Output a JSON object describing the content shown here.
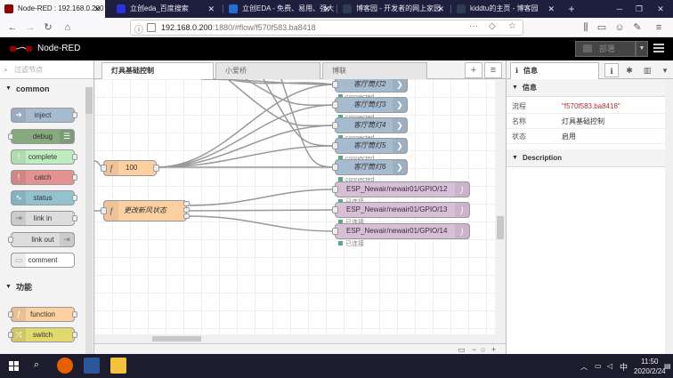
{
  "browser": {
    "tabs": [
      {
        "label": "Node-RED : 192.168.0.200",
        "fav_color": "#8f0000"
      },
      {
        "label": "立创eda_百度搜索",
        "fav_color": "#2932e1"
      },
      {
        "label": "立创EDA - 免费、易用、强大",
        "fav_color": "#1f6fd6"
      },
      {
        "label": "博客园 - 开发者的网上家园",
        "fav_color": "#2c3e50"
      },
      {
        "label": "kiddtu的主页 - 博客园",
        "fav_color": "#2c3e50"
      }
    ],
    "new_tab": "+",
    "url_host": "192.168.0.200",
    "url_rest": ":1880/#flow/f570f583.ba8418"
  },
  "nodered": {
    "logo": "Node-RED",
    "deploy_label": "部署"
  },
  "palette": {
    "filter_placeholder": "过滤节点",
    "cat_common": "common",
    "cat_function": "功能",
    "nodes": [
      {
        "label": "inject",
        "color": "#a6bbcf"
      },
      {
        "label": "debug",
        "color": "#87a980"
      },
      {
        "label": "complete",
        "color": "#c0edc0"
      },
      {
        "label": "catch",
        "color": "#e49191"
      },
      {
        "label": "status",
        "color": "#94c1d0"
      },
      {
        "label": "link in",
        "color": "#dddddd"
      },
      {
        "label": "link out",
        "color": "#dddddd"
      },
      {
        "label": "comment",
        "color": "#ffffff"
      },
      {
        "label": "function",
        "color": "#fdd0a2"
      },
      {
        "label": "switch",
        "color": "#e2d96e"
      }
    ]
  },
  "workspace": {
    "tabs": [
      "灯具基础控制",
      "小爱桥",
      "博联"
    ],
    "add": "+",
    "nodes": {
      "fn100": "100",
      "fnfan": "更改新风状态",
      "lamps": [
        "客厅筒灯2",
        "客厅筒灯3",
        "客厅筒灯4",
        "客厅筒灯5",
        "客厅筒灯6"
      ],
      "lamp_status": "connected",
      "esp": [
        "ESP_Newair/newair01/GPIO/12",
        "ESP_Newair/newair01/GPIO/13",
        "ESP_Newair/newair01/GPIO/14"
      ],
      "esp_status": "已连接"
    },
    "colors": {
      "function": "#fdd0a2",
      "lamp": "#a6bbcf",
      "esp": "#d8bfd8",
      "wire": "#999999"
    }
  },
  "sidebar": {
    "tab_label": "信息",
    "section_info": "信息",
    "rows": [
      {
        "k": "流程",
        "v": "\"f570f583.ba8418\""
      },
      {
        "k": "名称",
        "v": "灯具基础控制"
      },
      {
        "k": "状态",
        "v": "启用"
      }
    ],
    "section_desc": "Description"
  },
  "taskbar": {
    "ime": "中",
    "time": "11:50",
    "date": "2020/2/24"
  }
}
